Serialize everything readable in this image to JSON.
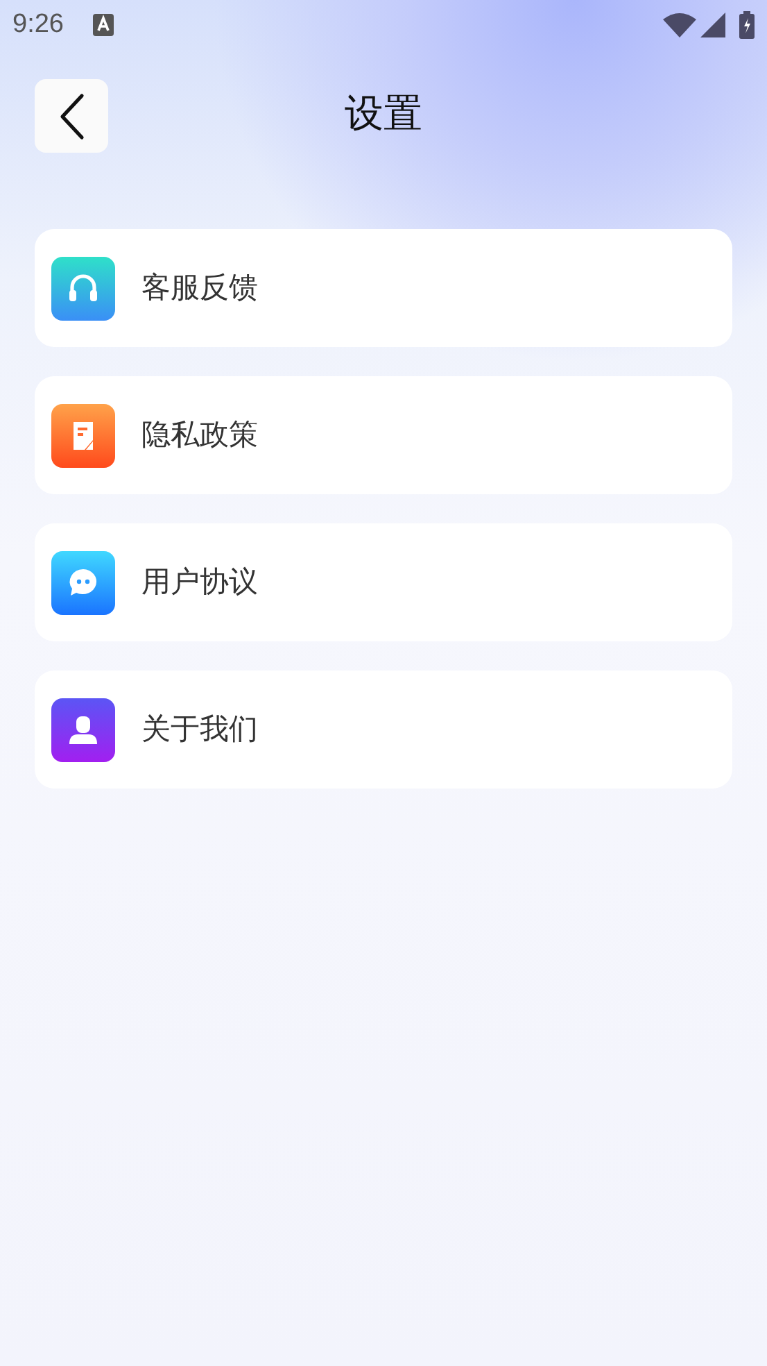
{
  "status_bar": {
    "time": "9:26"
  },
  "header": {
    "title": "设置"
  },
  "items": [
    {
      "kind": "headset",
      "label": "客服反馈"
    },
    {
      "kind": "document",
      "label": "隐私政策"
    },
    {
      "kind": "chat",
      "label": "用户协议"
    },
    {
      "kind": "person",
      "label": "关于我们"
    }
  ]
}
